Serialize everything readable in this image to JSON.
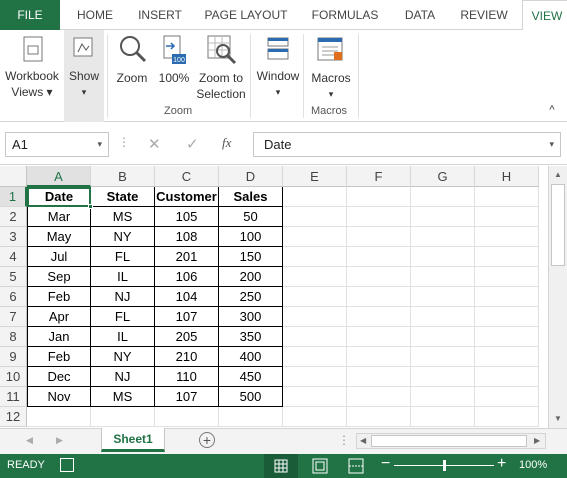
{
  "tabs": {
    "file": "FILE",
    "home": "HOME",
    "insert": "INSERT",
    "page_layout": "PAGE LAYOUT",
    "formulas": "FORMULAS",
    "data": "DATA",
    "review": "REVIEW",
    "view": "VIEW"
  },
  "ribbon": {
    "workbook_views": "Workbook\nViews",
    "workbook_line1": "Workbook",
    "workbook_line2": "Views",
    "show": "Show",
    "zoom": "Zoom",
    "zoom100": "100%",
    "zoom_sel_line1": "Zoom to",
    "zoom_sel_line2": "Selection",
    "window": "Window",
    "macros": "Macros",
    "group_zoom": "Zoom",
    "group_macros": "Macros"
  },
  "formula_bar": {
    "name_box": "A1",
    "fx": "fx",
    "value": "Date"
  },
  "columns": [
    "A",
    "B",
    "C",
    "D",
    "E",
    "F",
    "G",
    "H"
  ],
  "rows": [
    "1",
    "2",
    "3",
    "4",
    "5",
    "6",
    "7",
    "8",
    "9",
    "10",
    "11",
    "12"
  ],
  "table": {
    "headers": [
      "Date",
      "State",
      "Customer",
      "Sales"
    ],
    "rows": [
      [
        "Mar",
        "MS",
        "105",
        "50"
      ],
      [
        "May",
        "NY",
        "108",
        "100"
      ],
      [
        "Jul",
        "FL",
        "201",
        "150"
      ],
      [
        "Sep",
        "IL",
        "106",
        "200"
      ],
      [
        "Feb",
        "NJ",
        "104",
        "250"
      ],
      [
        "Apr",
        "FL",
        "107",
        "300"
      ],
      [
        "Jan",
        "IL",
        "205",
        "350"
      ],
      [
        "Feb",
        "NY",
        "210",
        "400"
      ],
      [
        "Dec",
        "NJ",
        "110",
        "450"
      ],
      [
        "Nov",
        "MS",
        "107",
        "500"
      ]
    ]
  },
  "sheet_tabs": [
    "Sheet1"
  ],
  "status": {
    "ready": "READY",
    "zoom": "100%",
    "minus": "−",
    "plus": "+"
  },
  "colors": {
    "accent": "#217346"
  }
}
